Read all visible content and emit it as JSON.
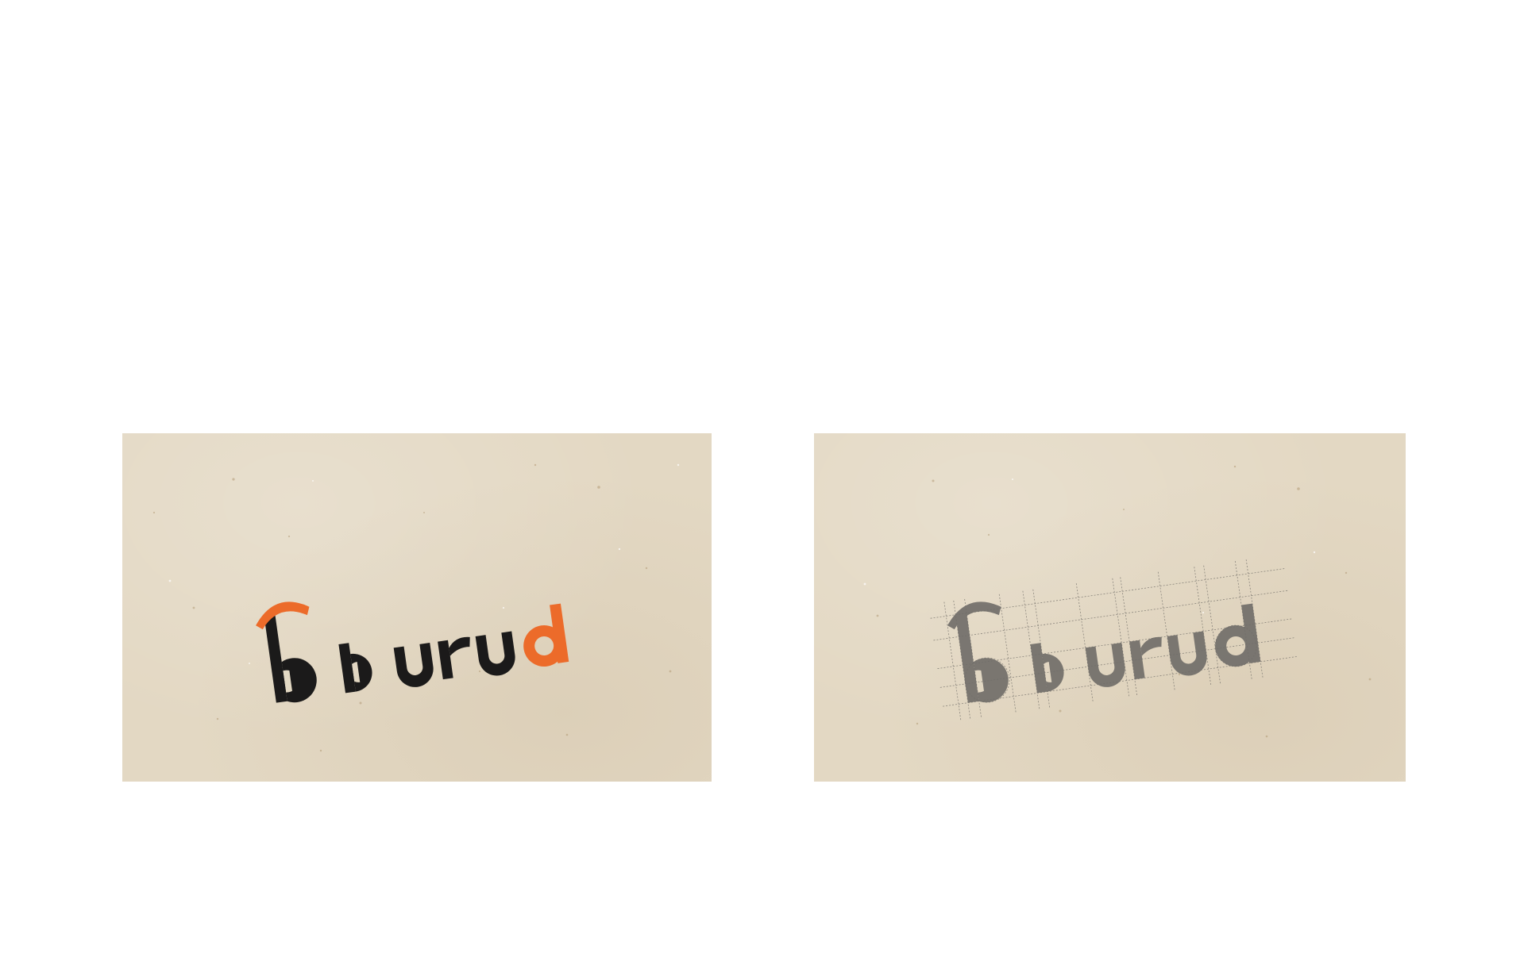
{
  "cards": [
    {
      "name": "color-logo-card",
      "logo_text": "buruд",
      "logo_wordmark": "burud",
      "colors": {
        "card": "#e3d8c3",
        "ink": "#1b1a1a",
        "accent": "#ec6b2a"
      }
    },
    {
      "name": "construction-grid-logo-card",
      "logo_text": "buruд",
      "logo_wordmark": "burud",
      "colors": {
        "card": "#e3d8c3",
        "ink": "#6f6c68",
        "grid": "#7b7770"
      }
    }
  ]
}
